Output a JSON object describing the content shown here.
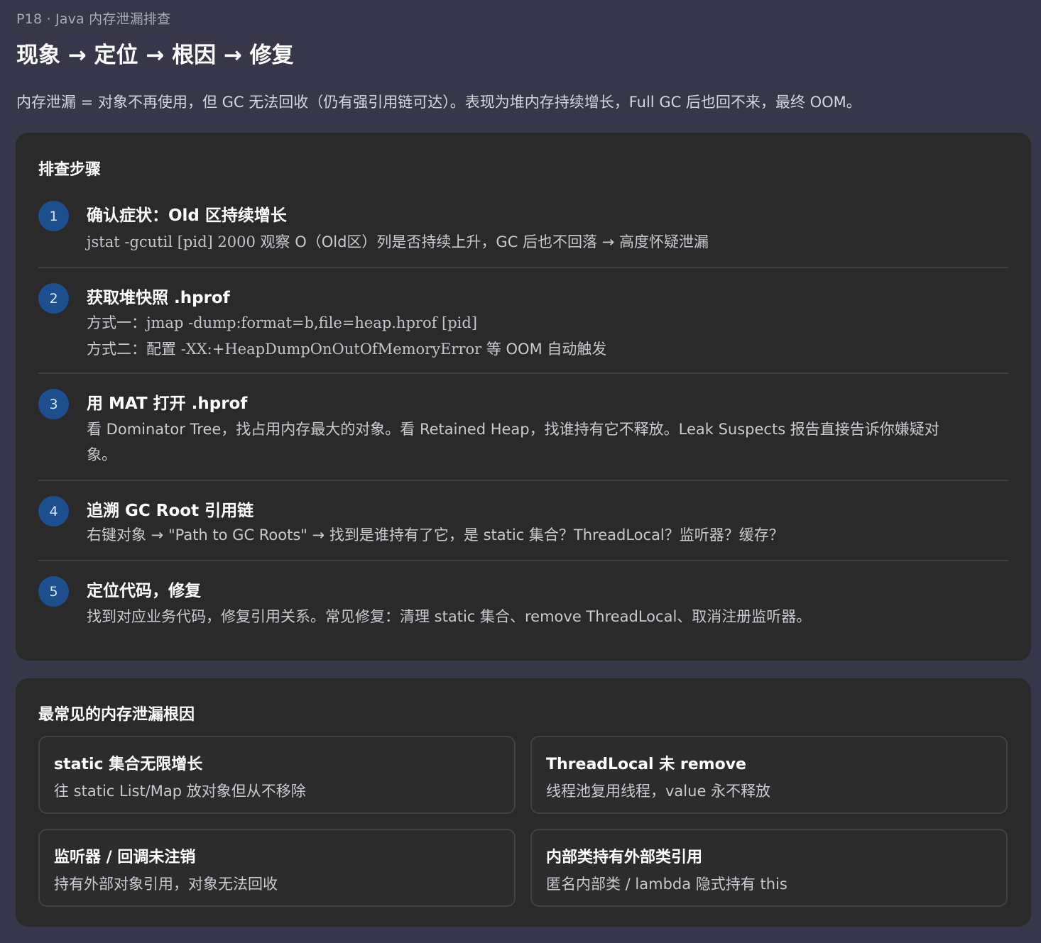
{
  "header": {
    "eyebrow": "P18 · Java 内存泄漏排查",
    "title": "现象 → 定位 → 根因 → 修复",
    "intro": "内存泄漏 = 对象不再使用，但 GC 无法回收（仍有强引用链可达）。表现为堆内存持续增长，Full GC 后也回不来，最终 OOM。"
  },
  "steps": {
    "heading": "排查步骤",
    "items": [
      {
        "num": "1",
        "title": "确认症状：Old 区持续增长",
        "line1_code": "jstat -gcutil [pid] 2000",
        "line1_text": " 观察 O（Old区）列是否持续上升，GC 后也不回落 → 高度怀疑泄漏"
      },
      {
        "num": "2",
        "title": "获取堆快照 .hprof",
        "line1_prefix": "方式一：",
        "line1_code": "jmap -dump:format=b,file=heap.hprof [pid]",
        "line2_prefix": "方式二：配置 ",
        "line2_code": "-XX:+HeapDumpOnOutOfMemoryError",
        "line2_suffix": " 等 OOM 自动触发"
      },
      {
        "num": "3",
        "title": "用 MAT 打开 .hprof",
        "line1_text": "看 Dominator Tree，找占用内存最大的对象。看 Retained Heap，找谁持有它不释放。Leak Suspects 报告直接告诉你嫌疑对",
        "line2_text": "象。"
      },
      {
        "num": "4",
        "title": "追溯 GC Root 引用链",
        "line1_text": "右键对象 → \"Path to GC Roots\" → 找到是谁持有了它，是 static 集合？ThreadLocal？监听器？缓存？"
      },
      {
        "num": "5",
        "title": "定位代码，修复",
        "line1_text": "找到对应业务代码，修复引用关系。常见修复：清理 static 集合、remove ThreadLocal、取消注册监听器。"
      }
    ]
  },
  "causes": {
    "heading": "最常见的内存泄漏根因",
    "items": [
      {
        "title": "static 集合无限增长",
        "desc": "往 static List/Map 放对象但从不移除"
      },
      {
        "title": "ThreadLocal 未 remove",
        "desc": "线程池复用线程，value 永不释放"
      },
      {
        "title": "监听器 / 回调未注销",
        "desc": "持有外部对象引用，对象无法回收"
      },
      {
        "title": "内部类持有外部类引用",
        "desc": "匿名内部类 / lambda 隐式持有 this"
      }
    ]
  }
}
